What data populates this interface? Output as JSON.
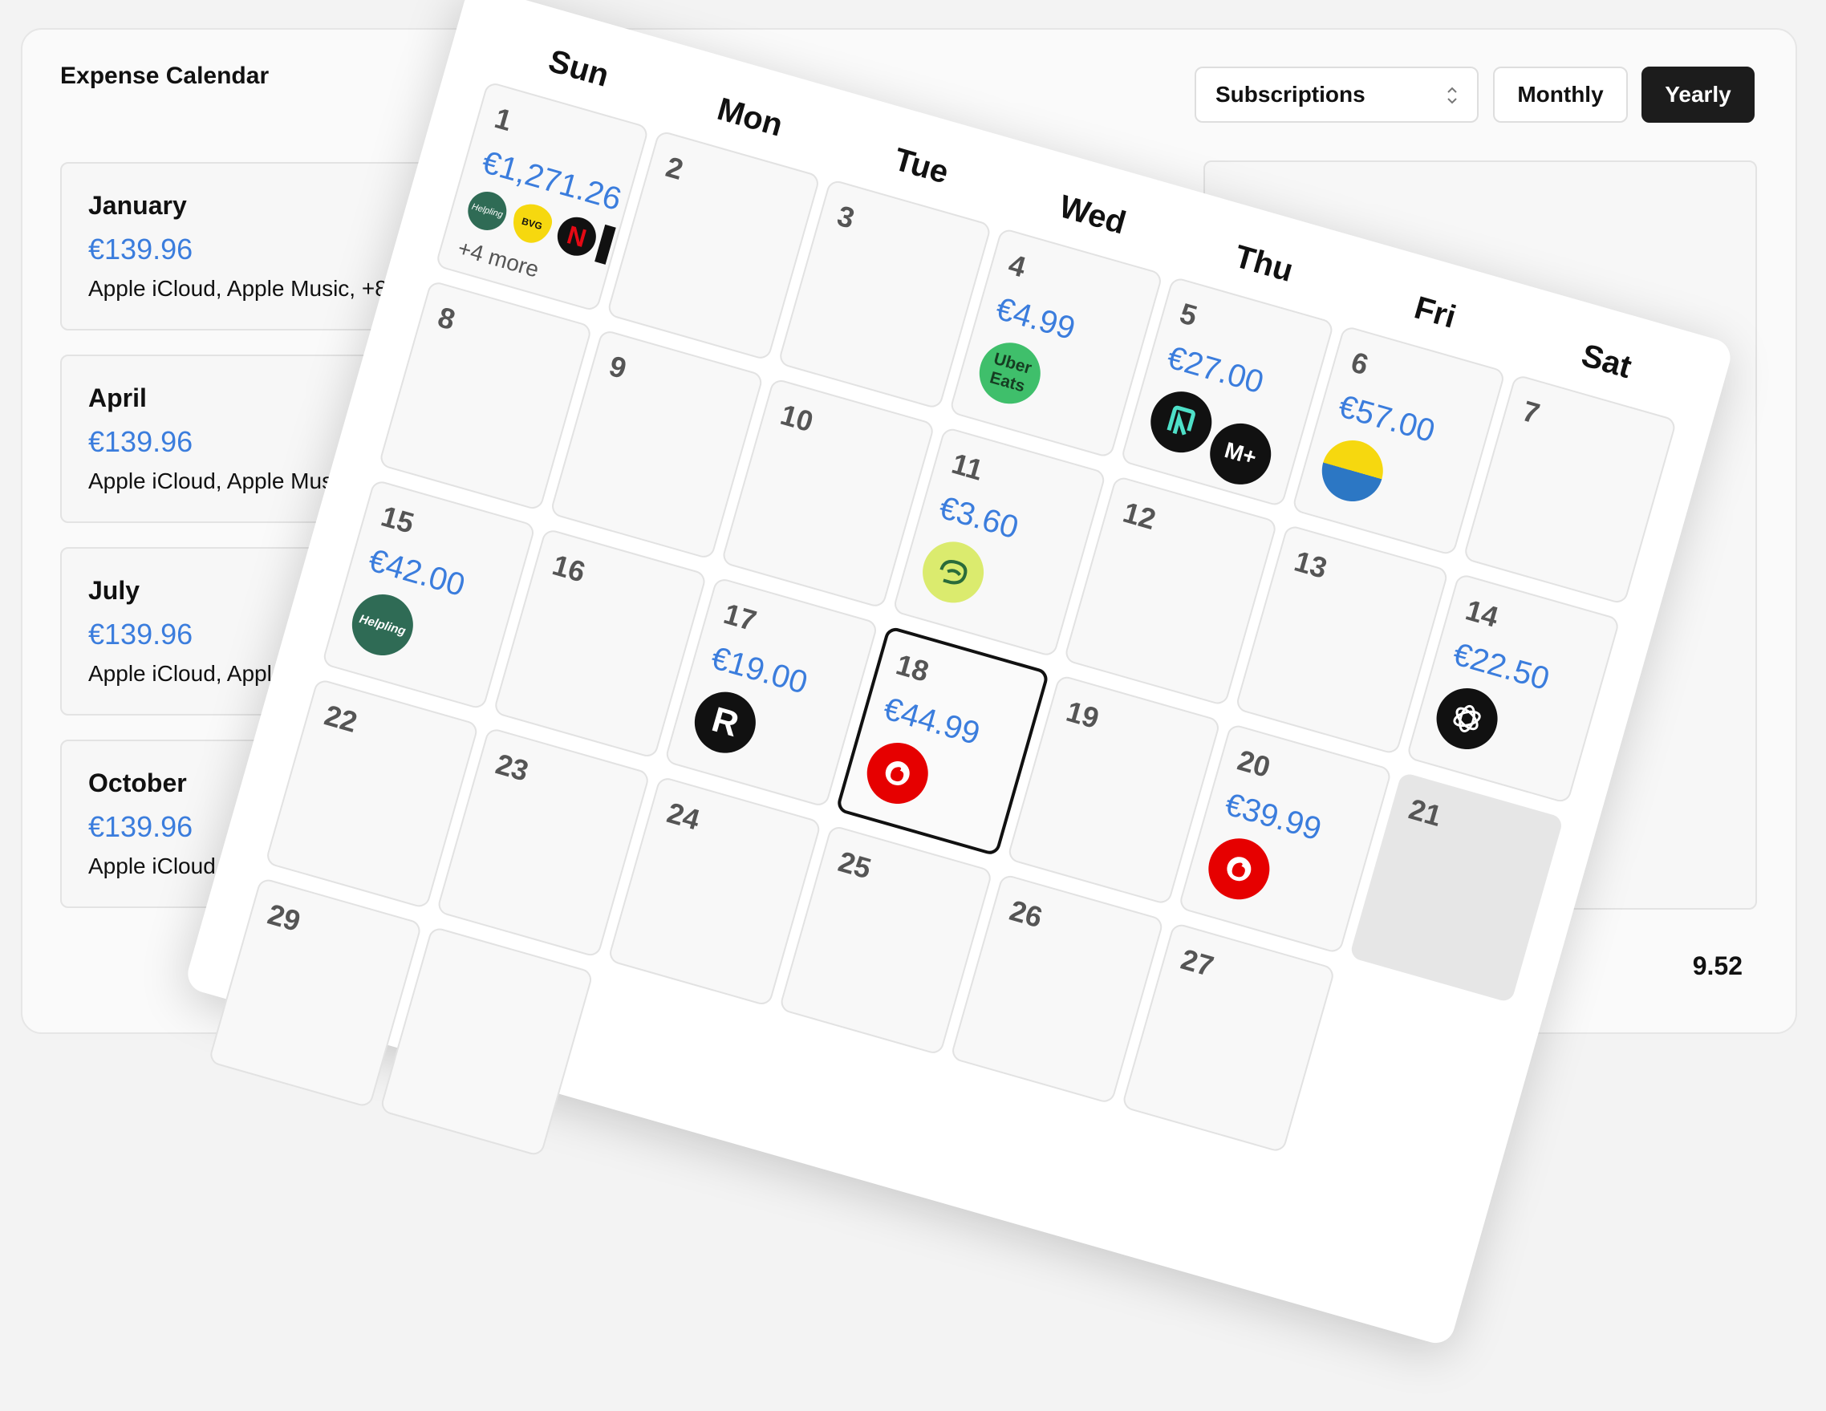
{
  "app": {
    "title": "Expense Calendar"
  },
  "controls": {
    "category_select": "Subscriptions",
    "monthly_label": "Monthly",
    "yearly_label": "Yearly"
  },
  "months": [
    {
      "name": "January",
      "amount": "€139.96",
      "desc": "Apple iCloud, Apple Music, +8"
    },
    {
      "name": "April",
      "amount": "€139.96",
      "desc": "Apple iCloud, Apple Music"
    },
    {
      "name": "July",
      "amount": "€139.96",
      "desc": "Apple iCloud, Apple M"
    },
    {
      "name": "October",
      "amount": "€139.96",
      "desc": "Apple iCloud, Ap"
    }
  ],
  "total": "9.52",
  "calendar": {
    "weekdays": [
      "Sun",
      "Mon",
      "Tue",
      "Wed",
      "Thu",
      "Fri",
      "Sat"
    ],
    "days": {
      "d1": {
        "num": "1",
        "amount": "€1,271.26",
        "more": "+4 more",
        "logos": [
          "helpling-icon",
          "bvg-icon",
          "netflix-icon"
        ]
      },
      "d2": {
        "num": "2"
      },
      "d3": {
        "num": "3"
      },
      "d4": {
        "num": "4",
        "amount": "€4.99",
        "logos": [
          "uber-eats-icon"
        ]
      },
      "d5": {
        "num": "5",
        "amount": "€27.00",
        "logos": [
          "n-app-icon",
          "movistar-plus-icon"
        ]
      },
      "d6": {
        "num": "6",
        "amount": "€57.00",
        "logos": [
          "yellow-blue-icon"
        ]
      },
      "d7": {
        "num": "7"
      },
      "d8": {
        "num": "8"
      },
      "d9": {
        "num": "9"
      },
      "d10": {
        "num": "10"
      },
      "d11": {
        "num": "11",
        "amount": "€3.60",
        "logos": [
          "green-lime-icon"
        ]
      },
      "d12": {
        "num": "12"
      },
      "d13": {
        "num": "13"
      },
      "d14": {
        "num": "14",
        "amount": "€22.50",
        "logos": [
          "openai-icon"
        ]
      },
      "d15": {
        "num": "15",
        "amount": "€42.00",
        "logos": [
          "helpling-icon"
        ]
      },
      "d16": {
        "num": "16"
      },
      "d17": {
        "num": "17",
        "amount": "€19.00",
        "logos": [
          "r-icon"
        ]
      },
      "d18": {
        "num": "18",
        "amount": "€44.99",
        "logos": [
          "vodafone-icon"
        ]
      },
      "d19": {
        "num": "19"
      },
      "d20": {
        "num": "20",
        "amount": "€39.99",
        "logos": [
          "vodafone-icon"
        ]
      },
      "d21": {
        "num": "21"
      },
      "d22": {
        "num": "22"
      },
      "d23": {
        "num": "23"
      },
      "d24": {
        "num": "24"
      },
      "d25": {
        "num": "25"
      },
      "d26": {
        "num": "26"
      },
      "d27": {
        "num": "27"
      },
      "d29": {
        "num": "29"
      }
    }
  },
  "logo_text": {
    "helpling": "Helpling",
    "bvg": "BVG",
    "netflix": "N",
    "uber_eats_1": "Uber",
    "uber_eats_2": "Eats",
    "movistar": "M+",
    "r": "R"
  },
  "colors": {
    "accent_blue": "#3b7ddd",
    "helpling_green": "#2f6b55",
    "vodafone_red": "#e60000",
    "uber_green": "#3fbf6b",
    "lime": "#dbeb6e",
    "dark": "#111111",
    "bvg_yellow": "#f6d80f"
  }
}
